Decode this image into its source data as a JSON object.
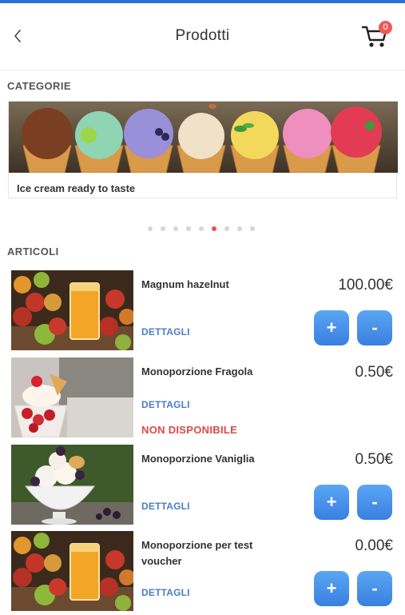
{
  "header": {
    "title": "Prodotti",
    "cart_count": "0"
  },
  "categories": {
    "section_label": "CATEGORIE",
    "current": {
      "caption": "Ice cream ready to taste"
    },
    "carousel_pages": 9,
    "active_page": 6
  },
  "articles": {
    "section_label": "ARTICOLI",
    "items": [
      {
        "name": "Magnum hazelnut",
        "price": "100.00€",
        "details_label": "DETTAGLI",
        "plus_label": "+",
        "minus_label": "-",
        "available": true
      },
      {
        "name": "Monoporzione Fragola",
        "price": "0.50€",
        "details_label": "DETTAGLI",
        "status": "NON DISPONIBILE",
        "available": false
      },
      {
        "name": "Monoporzione Vaniglia",
        "price": "0.50€",
        "details_label": "DETTAGLI",
        "plus_label": "+",
        "minus_label": "-",
        "available": true
      },
      {
        "name": "Monoporzione per test voucher",
        "price": "0.00€",
        "details_label": "DETTAGLI",
        "plus_label": "+",
        "minus_label": "-",
        "available": true
      }
    ]
  },
  "colors": {
    "accent": "#3a7fe0",
    "link": "#4a7ec9",
    "unavailable": "#e04848",
    "badge": "#ee5a5a"
  }
}
